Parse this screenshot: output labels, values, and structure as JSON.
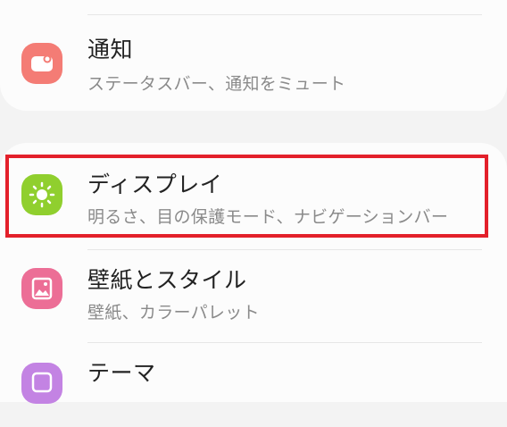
{
  "settings": {
    "items": [
      {
        "title": "通知",
        "subtitle": "ステータスバー、通知をミュート",
        "icon": "notification-icon",
        "color": "#f47c75"
      },
      {
        "title": "ディスプレイ",
        "subtitle": "明るさ、目の保護モード、ナビゲーションバー",
        "icon": "sun-icon",
        "color": "#90cf2e"
      },
      {
        "title": "壁紙とスタイル",
        "subtitle": "壁紙、カラーパレット",
        "icon": "wallpaper-icon",
        "color": "#ec6e96"
      },
      {
        "title": "テーマ",
        "subtitle": "",
        "icon": "theme-icon",
        "color": "#c383e3"
      }
    ]
  },
  "highlight": {
    "color": "#e3202a",
    "target": "ディスプレイ"
  }
}
